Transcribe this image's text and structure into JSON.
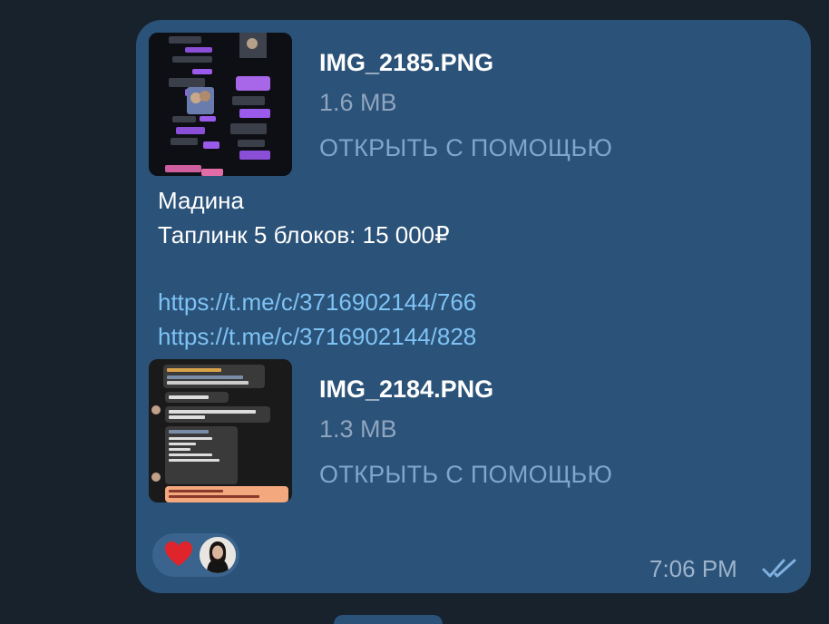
{
  "message": {
    "files": [
      {
        "name": "IMG_2185.PNG",
        "size": "1.6 MB",
        "action": "ОТКРЫТЬ С ПОМОЩЬЮ"
      },
      {
        "name": "IMG_2184.PNG",
        "size": "1.3 MB",
        "action": "ОТКРЫТЬ С ПОМОЩЬЮ"
      }
    ],
    "text_lines": [
      "Мадина",
      "Таплинк 5 блоков: 15 000₽"
    ],
    "links": [
      "https://t.me/c/3716902144/766",
      "https://t.me/c/3716902144/828"
    ],
    "time": "7:06 PM",
    "reaction": {
      "icon": "heart-icon",
      "user_icon": "avatar"
    },
    "status_icon": "double-check-icon"
  },
  "colors": {
    "background": "#18222d",
    "bubble": "#2b5278",
    "link": "#7ec3f5",
    "action": "#7fa6d0",
    "meta": "#9db4cc"
  }
}
